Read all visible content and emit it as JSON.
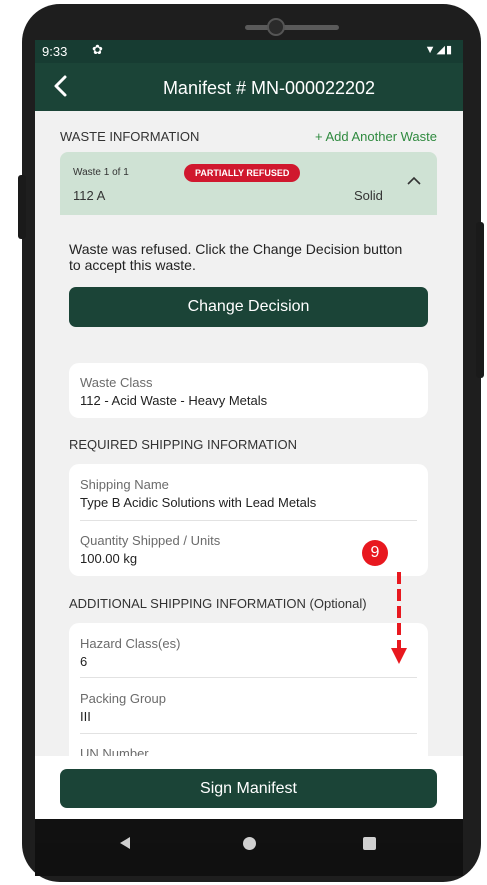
{
  "status_bar": {
    "time": "9:33",
    "gear_icon": "gear-icon",
    "icons": "▼◢▮"
  },
  "app_bar": {
    "title": "Manifest # MN-000022202",
    "back_icon": "back-arrow-icon"
  },
  "waste_information": {
    "section_title": "WASTE INFORMATION",
    "add_link": "+ Add Another Waste",
    "waste_count": "Waste 1 of 1",
    "badge": "PARTIALLY REFUSED",
    "waste_code": "112 A",
    "waste_type": "Solid",
    "refused_message": "Waste was refused. Click the Change Decision button to accept this waste.",
    "change_decision_label": "Change Decision"
  },
  "waste_class": {
    "label": "Waste Class",
    "value": "112 - Acid Waste - Heavy Metals"
  },
  "required_shipping": {
    "section_title": "REQUIRED SHIPPING INFORMATION",
    "shipping_name_label": "Shipping Name",
    "shipping_name_value": "Type B Acidic Solutions with Lead Metals",
    "quantity_label": "Quantity Shipped / Units",
    "quantity_value": "100.00 kg"
  },
  "additional_shipping": {
    "section_title": "ADDITIONAL SHIPPING INFORMATION (Optional)",
    "hazard_label": "Hazard Class(es)",
    "hazard_value": "6",
    "packing_label": "Packing Group",
    "packing_value": "III",
    "un_label": "UN Number"
  },
  "annotation": {
    "step_number": "9"
  },
  "footer": {
    "sign_label": "Sign Manifest"
  },
  "colors": {
    "brand_dark": "#1b4437",
    "badge_red": "#d0182e",
    "link_green": "#2f8a3f",
    "header_bg": "#cfe2d4"
  }
}
